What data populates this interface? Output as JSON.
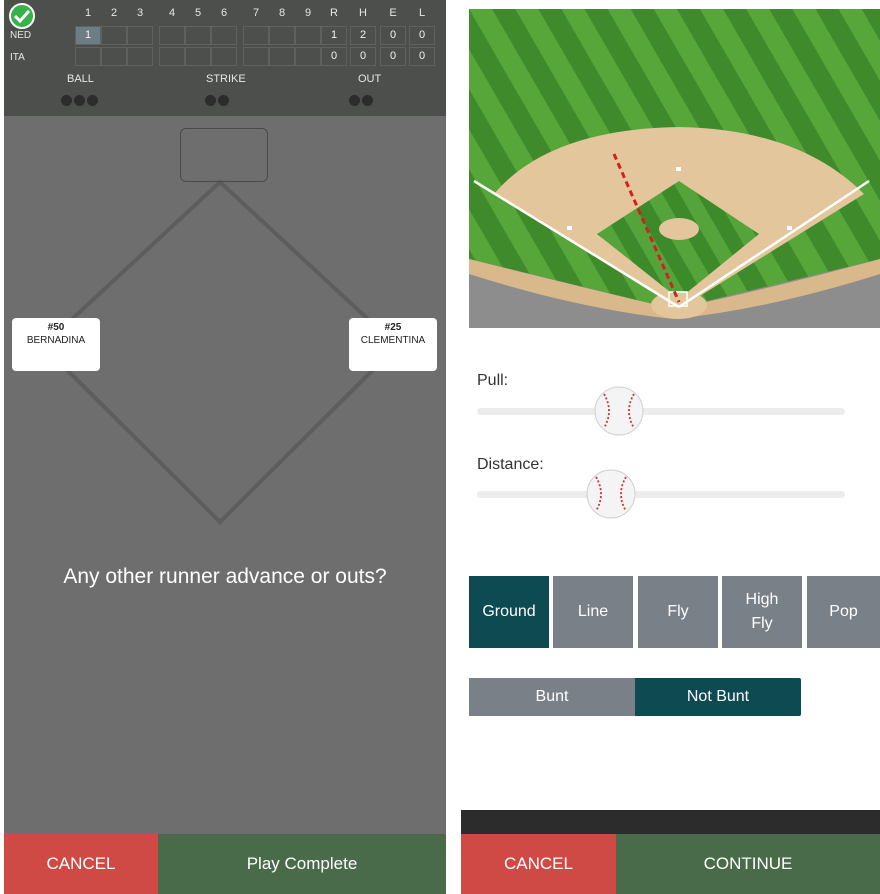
{
  "scoreboard": {
    "innings": [
      "1",
      "2",
      "3",
      "4",
      "5",
      "6",
      "7",
      "8",
      "9"
    ],
    "totals_headers": [
      "R",
      "H",
      "E",
      "L"
    ],
    "teams": [
      {
        "name": "NED",
        "innings": [
          "1",
          "",
          "",
          "",
          "",
          "",
          "",
          "",
          ""
        ],
        "totals": [
          "1",
          "2",
          "0",
          "0"
        ]
      },
      {
        "name": "ITA",
        "innings": [
          "",
          "",
          "",
          "",
          "",
          "",
          "",
          "",
          ""
        ],
        "totals": [
          "0",
          "0",
          "0",
          "0"
        ]
      }
    ],
    "count_labels": {
      "ball": "BALL",
      "strike": "STRIKE",
      "out": "OUT"
    },
    "count_dots": {
      "ball": 3,
      "strike": 2,
      "out": 2
    }
  },
  "runners": {
    "third": {
      "number": "#50",
      "name": "BERNADINA"
    },
    "first": {
      "number": "#25",
      "name": "CLEMENTINA"
    }
  },
  "left_panel": {
    "question": "Any other runner advance or outs?",
    "cancel_label": "CANCEL",
    "play_complete_label": "Play Complete"
  },
  "right_panel": {
    "pull_label": "Pull:",
    "pull_value": 0.36,
    "distance_label": "Distance:",
    "distance_value": 0.36,
    "hit_types": [
      {
        "label": "Ground",
        "selected": true
      },
      {
        "label": "Line",
        "selected": false
      },
      {
        "label": "Fly",
        "selected": false
      },
      {
        "label": "High Fly",
        "selected": false
      },
      {
        "label": "Pop",
        "selected": false
      }
    ],
    "bunt_options": [
      {
        "label": "Bunt",
        "selected": false
      },
      {
        "label": "Not Bunt",
        "selected": true
      }
    ],
    "cancel_label": "CANCEL",
    "continue_label": "CONTINUE"
  },
  "colors": {
    "selected": "#0d4a52",
    "unselected": "#7a8088",
    "cancel": "#cf4a45",
    "confirm": "#4a6b4a"
  }
}
